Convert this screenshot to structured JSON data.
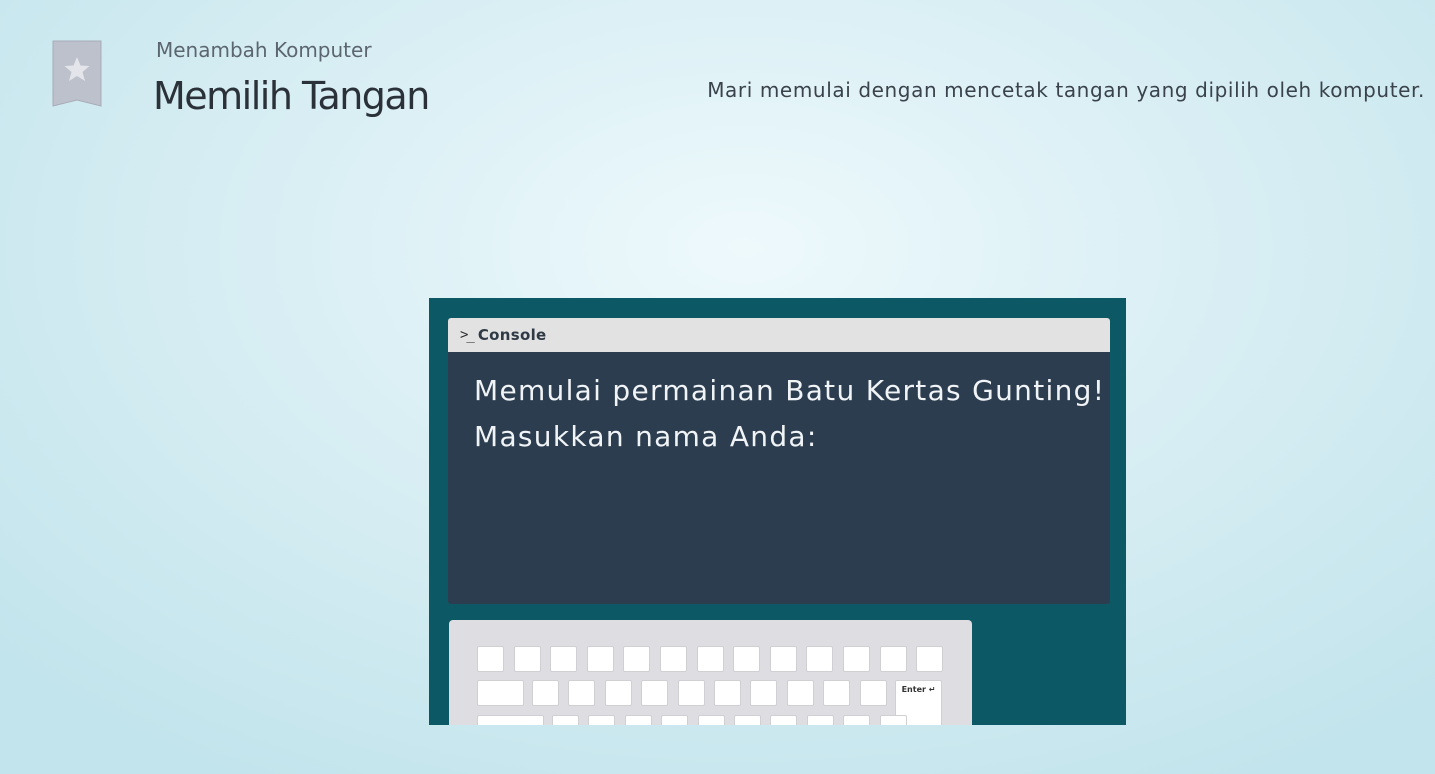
{
  "header": {
    "subtitle": "Menambah Komputer",
    "title": "Memilih Tangan",
    "instruction": "Mari memulai dengan mencetak tangan yang dipilih oleh komputer.",
    "bookmark_icon": "star-bookmark-icon"
  },
  "console": {
    "prompt_icon": "console-prompt-icon",
    "label": "Console",
    "lines": [
      "Memulai permainan Batu Kertas Gunting!",
      "Masukkan nama Anda:"
    ]
  },
  "keyboard": {
    "enter_label": "Enter ↵"
  },
  "colors": {
    "stage_background": "#0c5865",
    "console_background": "#2c3d4f",
    "console_bar": "#e2e2e2",
    "keyboard_background": "#dedde2"
  }
}
